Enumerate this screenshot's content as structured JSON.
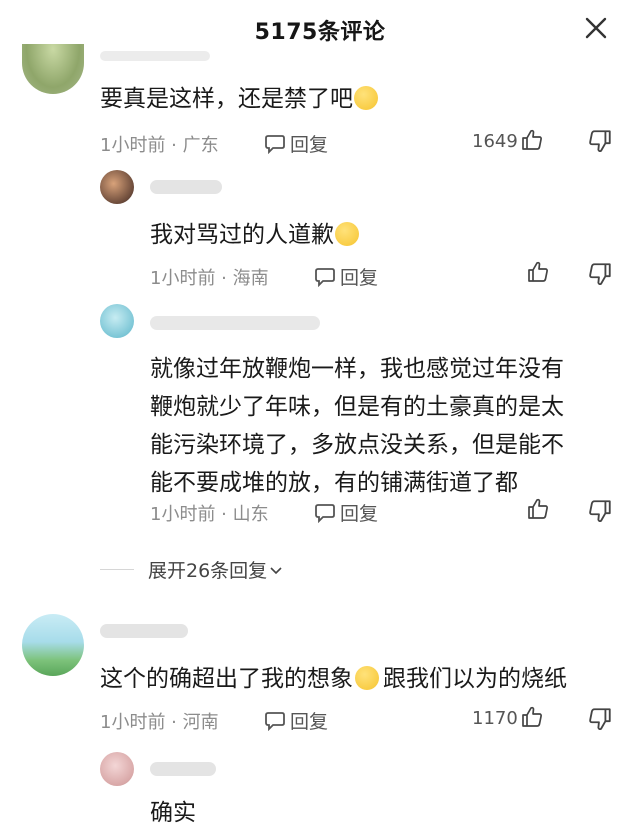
{
  "header": {
    "title": "5175条评论"
  },
  "comments": [
    {
      "text": "要真是这样，还是禁了吧",
      "emoji": "laughing-crying-emoji",
      "time_location": "1小时前 · 广东",
      "reply_label": "回复",
      "likes": "1649"
    },
    {
      "text": "我对骂过的人道歉",
      "emoji": "tears-of-joy-emoji",
      "time_location": "1小时前 · 海南",
      "reply_label": "回复",
      "likes": ""
    },
    {
      "lines": [
        "就像过年放鞭炮一样，我也感觉过年没有",
        "鞭炮就少了年味，但是有的土豪真的是太",
        "能污染环境了，多放点没关系，但是能不",
        "能不要成堆的放，有的铺满街道了都"
      ],
      "time_location": "1小时前 · 山东",
      "reply_label": "回复",
      "likes": ""
    },
    {
      "text_a": "这个的确超出了我的想象",
      "emoji": "dizzy-face-emoji",
      "text_b": "跟我们以为的烧纸",
      "time_location": "1小时前 · 河南",
      "reply_label": "回复",
      "likes": "1170"
    },
    {
      "text": "确实"
    }
  ],
  "expand_replies": {
    "label": "展开26条回复"
  },
  "colors": {
    "title": "#161616",
    "meta": "#8c8c8c",
    "text": "#1a1a1a",
    "emoji": "#f6c430"
  }
}
